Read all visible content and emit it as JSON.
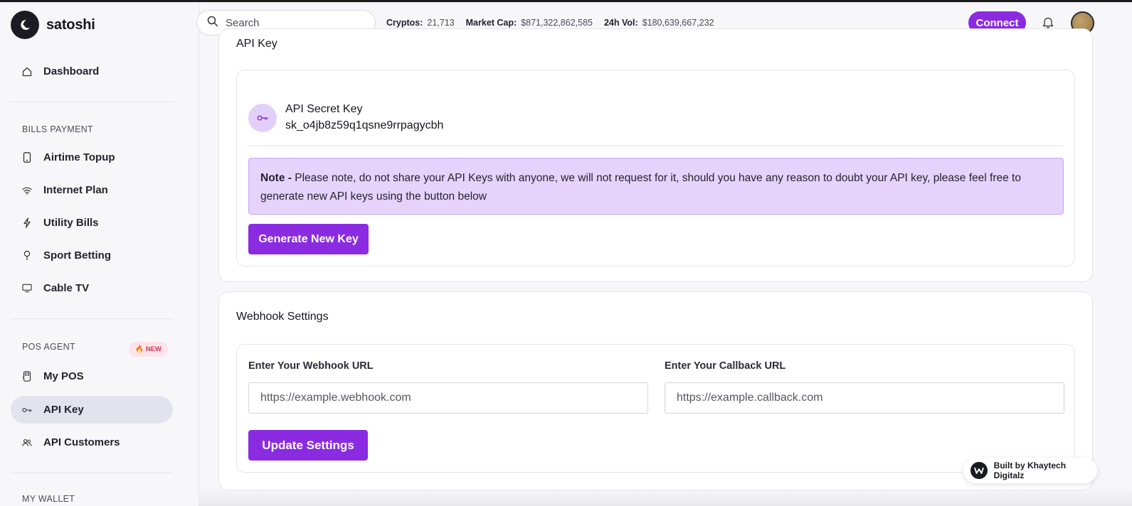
{
  "brand": {
    "name": "satoshi",
    "logo_icon": "moon-icon"
  },
  "sidebar": {
    "dashboard": "Dashboard",
    "sections": {
      "bills_payment": "BILLS PAYMENT",
      "pos_agent": "POS AGENT",
      "pos_badge": "NEW",
      "my_wallet": "MY WALLET"
    },
    "bills_items": [
      {
        "label": "Airtime Topup",
        "icon": "phone-icon"
      },
      {
        "label": "Internet Plan",
        "icon": "wifi-icon"
      },
      {
        "label": "Utility Bills",
        "icon": "bolt-icon"
      },
      {
        "label": "Sport Betting",
        "icon": "pin-icon"
      },
      {
        "label": "Cable TV",
        "icon": "tv-icon"
      }
    ],
    "pos_items": [
      {
        "label": "My POS",
        "icon": "pos-icon"
      },
      {
        "label": "API Key",
        "icon": "key-icon",
        "active": true
      },
      {
        "label": "API Customers",
        "icon": "users-icon"
      }
    ]
  },
  "header": {
    "search_placeholder": "Search",
    "stats": [
      {
        "key": "Cryptos:",
        "value": "21,713"
      },
      {
        "key": "Market Cap:",
        "value": "$871,322,862,585"
      },
      {
        "key": "24h Vol:",
        "value": "$180,639,667,232"
      }
    ],
    "connect_label": "Connect"
  },
  "api_key_card": {
    "title": "API Key",
    "secret_label": "API Secret Key",
    "secret_value": "sk_o4jb8z59q1qsne9rrpagycbh",
    "note_prefix": "Note -",
    "note_text": " Please note, do not share your API Keys with anyone, we will not request for it, should you have any reason to doubt your API key, please feel free to generate new API keys using the button below",
    "generate_label": "Generate New Key"
  },
  "webhook_card": {
    "title": "Webhook Settings",
    "webhook_label": "Enter Your Webhook URL",
    "webhook_placeholder": "https://example.webhook.com",
    "callback_label": "Enter Your Callback URL",
    "callback_placeholder": "https://example.callback.com",
    "update_label": "Update Settings"
  },
  "footer": {
    "built_by": "Built by Khaytech Digitalz"
  },
  "colors": {
    "accent": "#8a2be2",
    "note_bg": "#e5d3fc",
    "active_bg": "#e3e3ee"
  }
}
